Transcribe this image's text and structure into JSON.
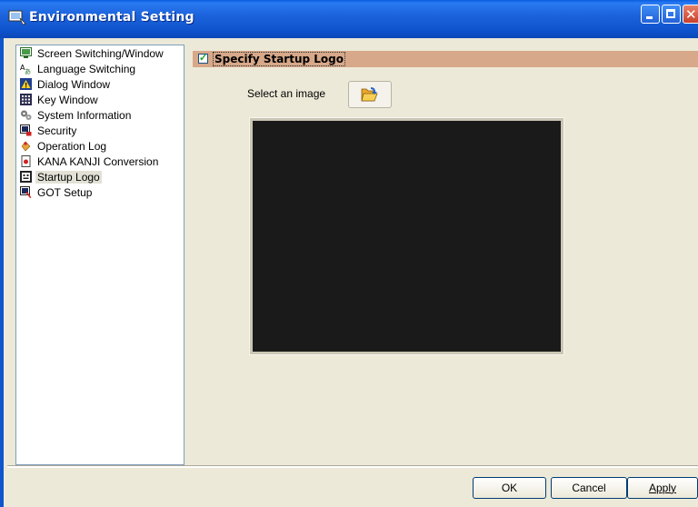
{
  "window": {
    "title": "Environmental Setting",
    "icon": "app-window-icon",
    "controls": [
      "minimize-icon",
      "maximize-icon",
      "close-icon"
    ]
  },
  "tree": {
    "items": [
      {
        "label": "Screen Switching/Window",
        "icon": "screen-switch-icon"
      },
      {
        "label": "Language Switching",
        "icon": "language-icon"
      },
      {
        "label": "Dialog Window",
        "icon": "warning-dialog-icon"
      },
      {
        "label": "Key Window",
        "icon": "keypad-icon"
      },
      {
        "label": "System Information",
        "icon": "gears-icon"
      },
      {
        "label": "Security",
        "icon": "security-icon"
      },
      {
        "label": "Operation Log",
        "icon": "operation-log-icon"
      },
      {
        "label": "KANA KANJI Conversion",
        "icon": "kana-kanji-icon"
      },
      {
        "label": "Startup Logo",
        "icon": "startup-logo-icon",
        "selected": true
      },
      {
        "label": "GOT Setup",
        "icon": "got-setup-icon"
      }
    ]
  },
  "startup_logo": {
    "checkbox_label": "Specify Startup Logo",
    "checked": true,
    "select_label": "Select an image",
    "browse_icon": "open-folder-icon"
  },
  "buttons": {
    "ok": "OK",
    "cancel": "Cancel",
    "apply": "Apply"
  },
  "colors": {
    "title_bar": "#1b63dc",
    "section_bar": "#d7a889",
    "preview_bg": "#1b1a1a"
  }
}
